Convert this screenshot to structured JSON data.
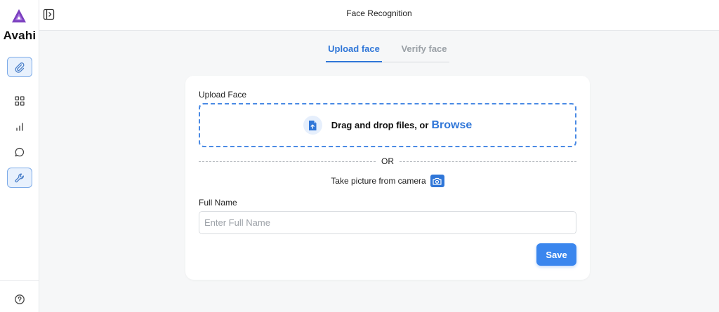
{
  "app": {
    "logo_text": "Avahi",
    "logo_icon": "avahi-logo-icon",
    "brand_color": "#7b3fbf",
    "accent_color": "#2f76d8"
  },
  "sidebar": {
    "items": [
      {
        "icon": "paperclip-icon",
        "active": true
      },
      {
        "icon": "grid-icon",
        "active": false
      },
      {
        "icon": "bar-chart-icon",
        "active": false
      },
      {
        "icon": "chat-bubble-icon",
        "active": false
      },
      {
        "icon": "wrench-icon",
        "active": true
      }
    ],
    "footer_icon": "help-circle-icon"
  },
  "header": {
    "title": "Face Recognition",
    "collapse_icon": "sidebar-toggle-icon"
  },
  "tabs": [
    {
      "label": "Upload face",
      "active": true
    },
    {
      "label": "Verify face",
      "active": false
    }
  ],
  "form": {
    "upload_label": "Upload Face",
    "dropzone_text": "Drag and drop files, or",
    "browse_label": "Browse",
    "dropzone_icon": "file-upload-icon",
    "or_text": "OR",
    "camera_text": "Take picture from camera",
    "camera_icon": "camera-icon",
    "full_name_label": "Full Name",
    "full_name_placeholder": "Enter Full Name",
    "full_name_value": "",
    "save_label": "Save"
  }
}
